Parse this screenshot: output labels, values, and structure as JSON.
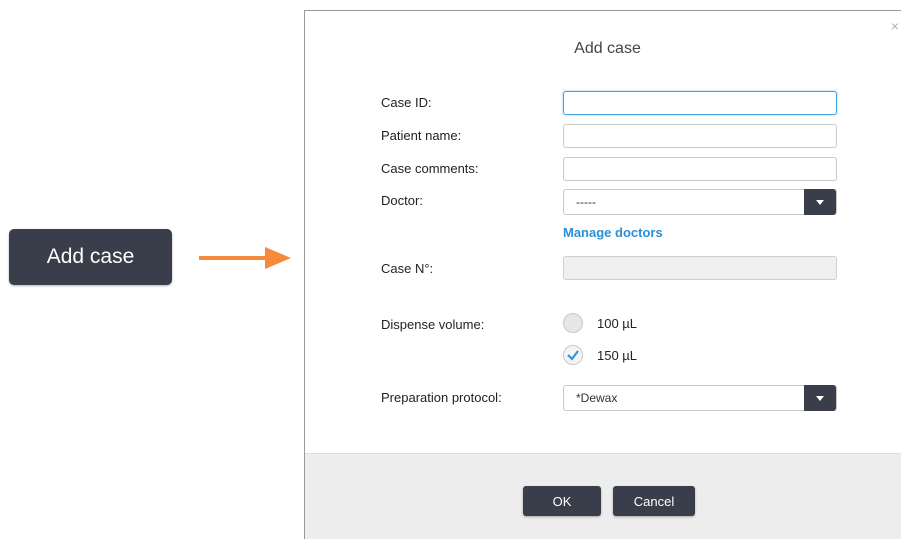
{
  "external_button": {
    "label": "Add case"
  },
  "dialog": {
    "title": "Add case",
    "close_label": "×",
    "fields": {
      "case_id": {
        "label": "Case ID:",
        "value": ""
      },
      "patient_name": {
        "label": "Patient name:",
        "value": ""
      },
      "case_comments": {
        "label": "Case comments:",
        "value": ""
      },
      "doctor": {
        "label": "Doctor:",
        "selected": "-----"
      },
      "manage_doctors": "Manage doctors",
      "case_no": {
        "label": "Case N°:",
        "value": ""
      },
      "dispense_volume": {
        "label": "Dispense volume:",
        "options": [
          "100 µL",
          "150 µL"
        ],
        "selected": "150 µL"
      },
      "preparation_protocol": {
        "label": "Preparation protocol:",
        "selected": "*Dewax"
      }
    },
    "buttons": {
      "ok": "OK",
      "cancel": "Cancel"
    }
  },
  "colors": {
    "button_dark": "#3a3d4a",
    "arrow": "#f58a3c",
    "link": "#2c8fd4",
    "focus": "#4aa3df",
    "check": "#2c8fd4"
  }
}
